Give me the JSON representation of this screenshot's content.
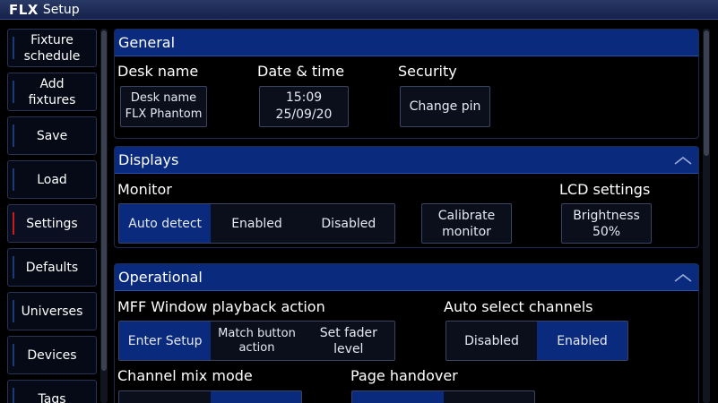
{
  "window": {
    "logo": "FLX",
    "title": "Setup"
  },
  "sidebar": {
    "items": [
      {
        "label": "Fixture schedule"
      },
      {
        "label": "Add fixtures"
      },
      {
        "label": "Save"
      },
      {
        "label": "Load"
      },
      {
        "label": "Settings",
        "active": true
      },
      {
        "label": "Defaults"
      },
      {
        "label": "Universes"
      },
      {
        "label": "Devices"
      },
      {
        "label": "Tags"
      }
    ]
  },
  "general": {
    "title": "General",
    "desk_name_label": "Desk name",
    "desk_name_btn_line1": "Desk name",
    "desk_name_btn_line2": "FLX Phantom",
    "datetime_label": "Date & time",
    "time": "15:09",
    "date": "25/09/20",
    "security_label": "Security",
    "change_pin": "Change pin"
  },
  "displays": {
    "title": "Displays",
    "monitor_label": "Monitor",
    "monitor_options": [
      "Auto detect",
      "Enabled",
      "Disabled"
    ],
    "monitor_selected": "Auto detect",
    "calibrate_line1": "Calibrate",
    "calibrate_line2": "monitor",
    "lcd_label": "LCD settings",
    "brightness_label": "Brightness",
    "brightness_value": "50%"
  },
  "operational": {
    "title": "Operational",
    "mff_label": "MFF Window playback action",
    "mff_options": [
      "Enter Setup",
      "Match button action",
      "Set fader level"
    ],
    "mff_selected": "Enter Setup",
    "auto_select_label": "Auto select channels",
    "auto_select_options": [
      "Disabled",
      "Enabled"
    ],
    "auto_select_selected": "Enabled",
    "channel_mix_label": "Channel mix mode",
    "page_handover_label": "Page handover"
  },
  "colors": {
    "accent": "#0a2a7e",
    "active_marker": "#c81d1d"
  },
  "icons": {
    "collapse": "chevron-up-icon"
  }
}
